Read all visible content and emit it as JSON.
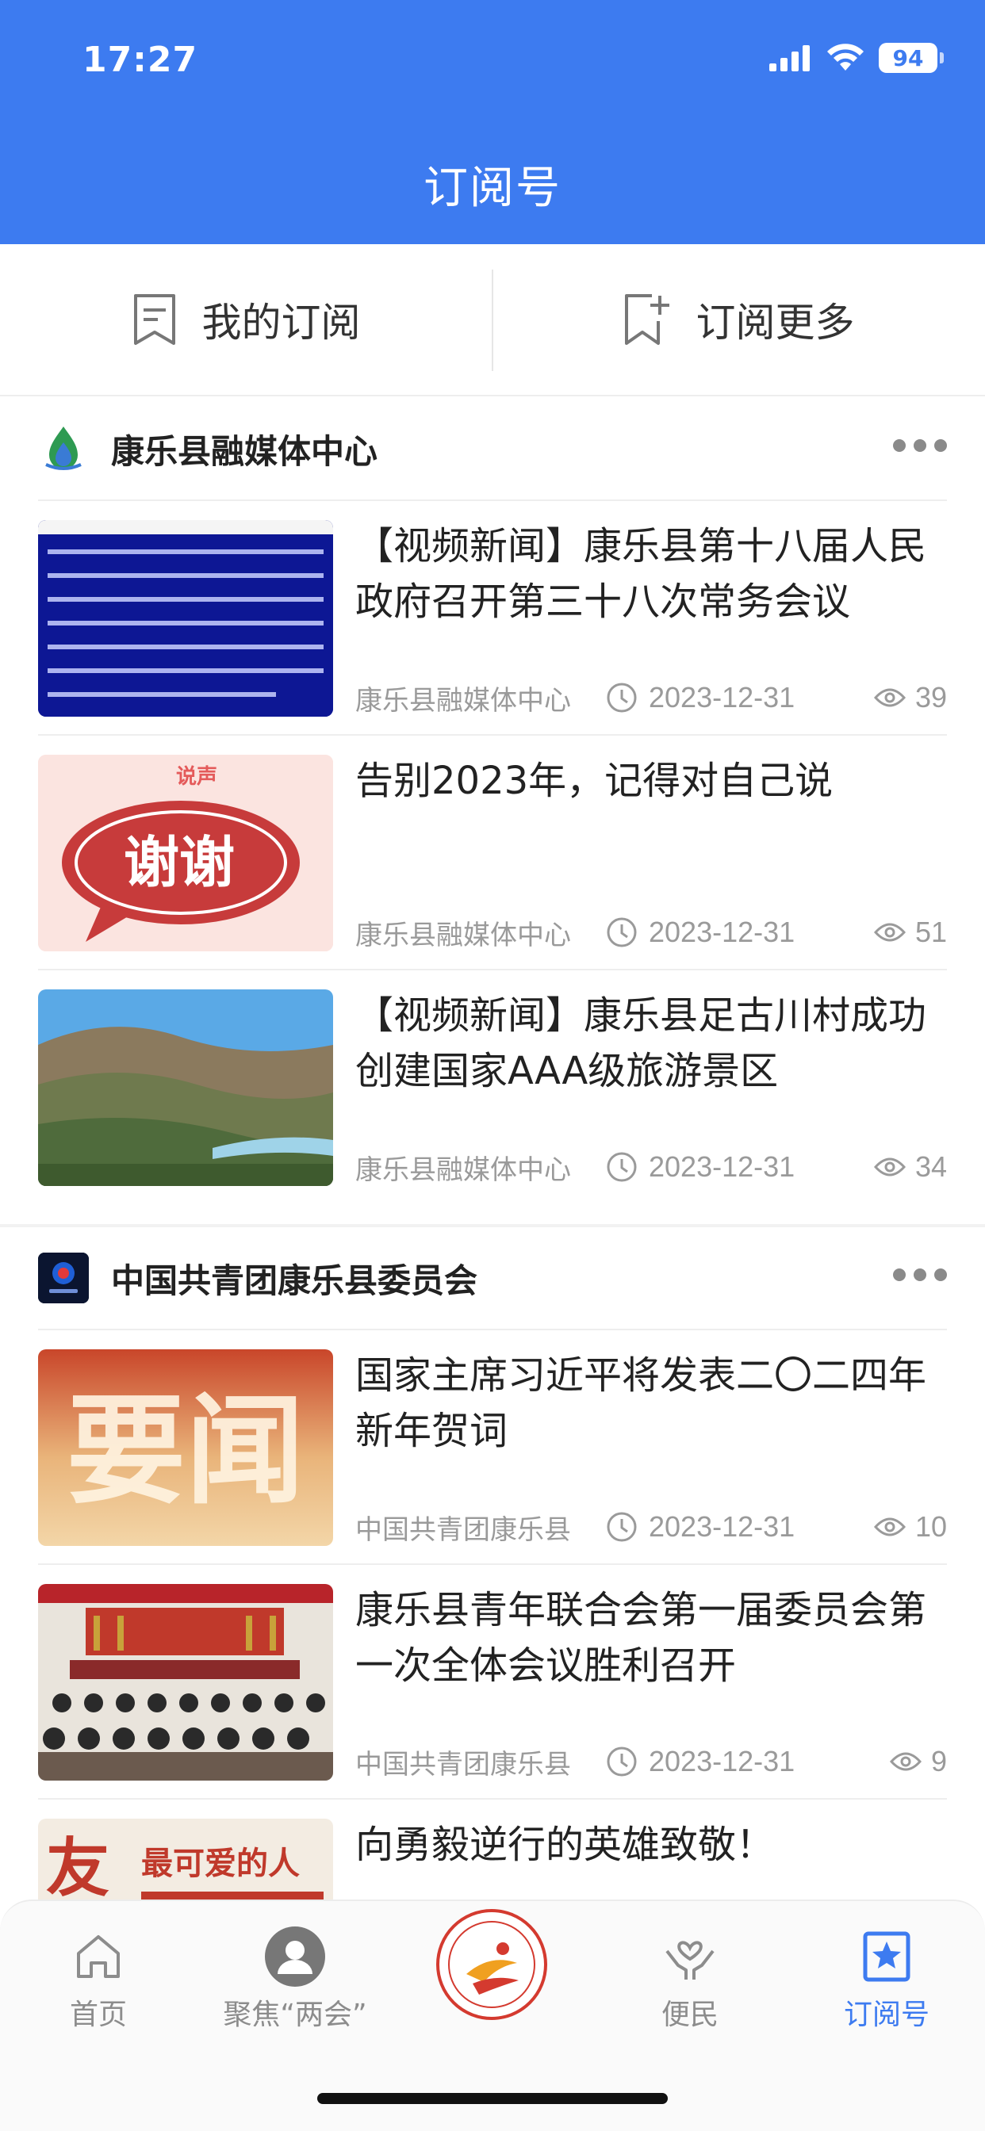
{
  "status_bar": {
    "time": "17:27",
    "battery": "94"
  },
  "header": {
    "title": "订阅号"
  },
  "sub_tabs": {
    "my_subscriptions": "我的订阅",
    "subscribe_more": "订阅更多"
  },
  "channels": [
    {
      "name": "康乐县融媒体中心",
      "articles": [
        {
          "title": "【视频新闻】康乐县第十八届人民政府召开第三十八次常务会议",
          "source": "康乐县融媒体中心",
          "date": "2023-12-31",
          "views": "39"
        },
        {
          "title": "告别2023年，记得对自己说",
          "source": "康乐县融媒体中心",
          "date": "2023-12-31",
          "views": "51",
          "thumb_text_top": "说声",
          "thumb_text_main": "谢谢"
        },
        {
          "title": "【视频新闻】康乐县足古川村成功创建国家AAA级旅游景区",
          "source": "康乐县融媒体中心",
          "date": "2023-12-31",
          "views": "34"
        }
      ]
    },
    {
      "name": "中国共青团康乐县委员会",
      "articles": [
        {
          "title": "国家主席习近平将发表二〇二四年新年贺词",
          "source": "中国共青团康乐县",
          "date": "2023-12-31",
          "views": "10",
          "thumb_text_main": "要闻"
        },
        {
          "title": "康乐县青年联合会第一届委员会第一次全体会议胜利召开",
          "source": "中国共青团康乐县",
          "date": "2023-12-31",
          "views": "9"
        },
        {
          "title": "向勇毅逆行的英雄致敬！",
          "thumb_text_main": "最可爱的人",
          "thumb_text_side": "友"
        }
      ]
    }
  ],
  "bottom_nav": {
    "items": [
      {
        "label": "首页",
        "icon": "home-icon"
      },
      {
        "label": "聚焦“两会”",
        "icon": "user-avatar-icon"
      },
      {
        "label": "便民",
        "icon": "helping-hands-icon"
      },
      {
        "label": "订阅号",
        "icon": "bookmark-star-icon"
      }
    ],
    "active": "订阅号",
    "center_icon": "emblem-logo-icon"
  },
  "colors": {
    "primary": "#3d7bf0",
    "meta_text": "#9a9a9a",
    "nav_inactive": "#8c8c8c"
  }
}
